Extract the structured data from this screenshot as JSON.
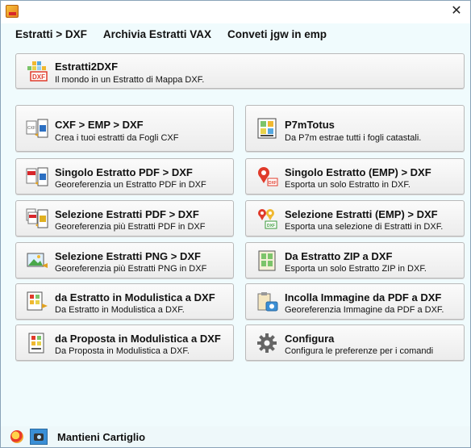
{
  "menu": {
    "items": [
      {
        "label": "Estratti > DXF"
      },
      {
        "label": "Archivia Estratti VAX"
      },
      {
        "label": "Conveti jgw in emp"
      }
    ]
  },
  "window": {
    "close_glyph": "✕"
  },
  "header_button": {
    "title": "Estratti2DXF",
    "subtitle": "Il mondo in un Estratto di Mappa DXF.",
    "icon": "dxf-tiles-icon"
  },
  "buttons": [
    {
      "title": "CXF > EMP > DXF",
      "subtitle": "Crea i tuoi estratti da Fogli CXF",
      "icon": "cxf-convert-icon"
    },
    {
      "title": "P7mTotus",
      "subtitle": "Da P7m estrae tutti i fogli catastali.",
      "icon": "p7m-grid-icon"
    },
    {
      "title": "Singolo Estratto PDF > DXF",
      "subtitle": "Georeferenzia un Estratto PDF in DXF",
      "icon": "pdf-to-dxf-icon"
    },
    {
      "title": "Singolo Estratto (EMP) > DXF",
      "subtitle": "Esporta un solo Estratto in DXF.",
      "icon": "map-pin-icon"
    },
    {
      "title": "Selezione Estratti PDF > DXF",
      "subtitle": "Georeferenzia più Estratti PDF in DXF",
      "icon": "multi-pdf-icon"
    },
    {
      "title": "Selezione Estratti (EMP) > DXF",
      "subtitle": "Esporta una selezione di Estratti in DXF.",
      "icon": "multi-pin-icon"
    },
    {
      "title": "Selezione Estratti PNG > DXF",
      "subtitle": "Georeferenzia più Estratti PNG in DXF",
      "icon": "png-image-icon"
    },
    {
      "title": "Da Estratto ZIP a DXF",
      "subtitle": "Esporta un solo Estratto ZIP in DXF.",
      "icon": "zip-archive-icon"
    },
    {
      "title": "da Estratto in Modulistica a DXF",
      "subtitle": "Da Estratto in Modulistica a DXF.",
      "icon": "form-extract-icon"
    },
    {
      "title": "Incolla Immagine da PDF a DXF",
      "subtitle": "Georeferenzia Immagine da PDF a DXF.",
      "icon": "paste-camera-icon"
    },
    {
      "title": "da Proposta in Modulistica a DXF",
      "subtitle": "Da Proposta in Modulistica a DXF.",
      "icon": "form-proposal-icon"
    },
    {
      "title": "Configura",
      "subtitle": "Configura le preferenze per i comandi",
      "icon": "gear-icon"
    }
  ],
  "statusbar": {
    "label": "Mantieni Cartiglio",
    "icons": [
      "palette-icon",
      "camera-icon"
    ]
  },
  "colors": {
    "background": "#f0fbfd",
    "dxf_red": "#e03a2a",
    "pdf_red": "#d8262b",
    "accent_blue": "#2b6fc2"
  }
}
